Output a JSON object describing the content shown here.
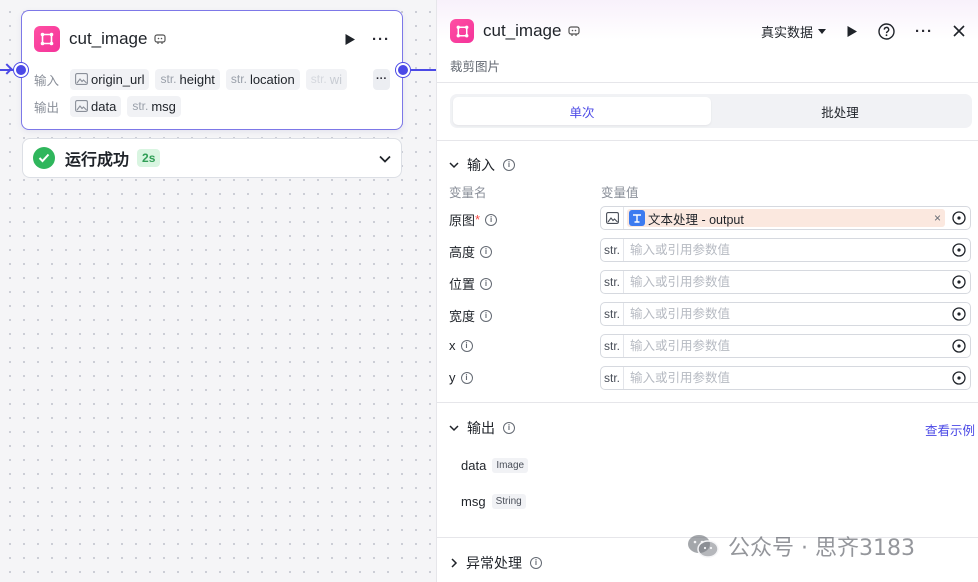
{
  "canvas": {
    "node": {
      "title": "cut_image",
      "input_label": "输入",
      "inputs": [
        {
          "type": "",
          "name": "origin_url",
          "kind": "image"
        },
        {
          "type": "str.",
          "name": "height",
          "kind": "str"
        },
        {
          "type": "str.",
          "name": "location",
          "kind": "str"
        },
        {
          "type": "str.",
          "name": "wi",
          "kind": "str",
          "faded": true
        }
      ],
      "more": "···",
      "output_label": "输出",
      "outputs": [
        {
          "type": "",
          "name": "data",
          "kind": "image"
        },
        {
          "type": "str.",
          "name": "msg",
          "kind": "str"
        }
      ]
    },
    "status": {
      "text": "运行成功",
      "time": "2s"
    }
  },
  "panel": {
    "title": "cut_image",
    "description": "裁剪图片",
    "data_mode": "真实数据",
    "tabs": [
      {
        "label": "单次",
        "active": true
      },
      {
        "label": "批处理",
        "active": false
      }
    ],
    "input_section": {
      "title": "输入",
      "col_name": "变量名",
      "col_value": "变量值",
      "variables": [
        {
          "label": "原图",
          "required": true,
          "type": "image",
          "ref": "文本处理 - output"
        },
        {
          "label": "高度",
          "type": "str.",
          "placeholder": "输入或引用参数值"
        },
        {
          "label": "位置",
          "type": "str.",
          "placeholder": "输入或引用参数值"
        },
        {
          "label": "宽度",
          "type": "str.",
          "placeholder": "输入或引用参数值"
        },
        {
          "label": "x",
          "type": "str.",
          "placeholder": "输入或引用参数值"
        },
        {
          "label": "y",
          "type": "str.",
          "placeholder": "输入或引用参数值"
        }
      ]
    },
    "output_section": {
      "title": "输出",
      "example_link": "查看示例",
      "items": [
        {
          "name": "data",
          "type": "Image"
        },
        {
          "name": "msg",
          "type": "String"
        }
      ]
    },
    "error_section": {
      "title": "异常处理"
    }
  },
  "watermark": "公众号 · 思齐3183",
  "colors": {
    "accent": "#4b49e6",
    "app_icon": "#f4339a",
    "success": "#2fb65c",
    "ref_chip_bg": "#fbe8df"
  }
}
